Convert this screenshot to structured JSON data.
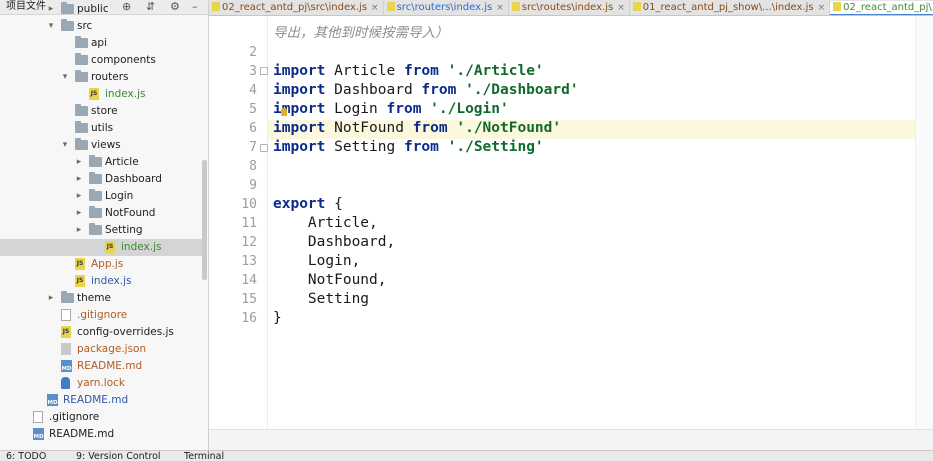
{
  "panel": {
    "title": "项目文件",
    "rows": [
      {
        "label": "public",
        "kind": "folder",
        "color": "c-dark",
        "expanded": false,
        "depth": 1
      },
      {
        "label": "src",
        "kind": "folder",
        "color": "c-dark",
        "expanded": true,
        "depth": 1
      },
      {
        "label": "api",
        "kind": "folder",
        "color": "c-dark",
        "expanded": null,
        "depth": 2
      },
      {
        "label": "components",
        "kind": "folder",
        "color": "c-dark",
        "expanded": null,
        "depth": 2
      },
      {
        "label": "routers",
        "kind": "folder",
        "color": "c-dark",
        "expanded": true,
        "depth": 2
      },
      {
        "label": "index.js",
        "kind": "js",
        "color": "c-green",
        "expanded": null,
        "depth": 3
      },
      {
        "label": "store",
        "kind": "folder",
        "color": "c-dark",
        "expanded": null,
        "depth": 2
      },
      {
        "label": "utils",
        "kind": "folder",
        "color": "c-dark",
        "expanded": null,
        "depth": 2
      },
      {
        "label": "views",
        "kind": "folder",
        "color": "c-dark",
        "expanded": true,
        "depth": 2
      },
      {
        "label": "Article",
        "kind": "folder",
        "color": "c-dark",
        "expanded": false,
        "depth": 3
      },
      {
        "label": "Dashboard",
        "kind": "folder",
        "color": "c-dark",
        "expanded": false,
        "depth": 3
      },
      {
        "label": "Login",
        "kind": "folder",
        "color": "c-dark",
        "expanded": false,
        "depth": 3
      },
      {
        "label": "NotFound",
        "kind": "folder",
        "color": "c-dark",
        "expanded": false,
        "depth": 3
      },
      {
        "label": "Setting",
        "kind": "folder",
        "color": "c-dark",
        "expanded": false,
        "depth": 3
      },
      {
        "label": "index.js",
        "kind": "js",
        "color": "c-green",
        "expanded": null,
        "depth": 4,
        "selected": true
      },
      {
        "label": "App.js",
        "kind": "js",
        "color": "c-orange",
        "expanded": null,
        "depth": 2
      },
      {
        "label": "index.js",
        "kind": "js",
        "color": "c-blue",
        "expanded": null,
        "depth": 2
      },
      {
        "label": "theme",
        "kind": "folder",
        "color": "c-dark",
        "expanded": false,
        "depth": 1
      },
      {
        "label": ".gitignore",
        "kind": "git",
        "color": "c-orange",
        "expanded": null,
        "depth": 1
      },
      {
        "label": "config-overrides.js",
        "kind": "js",
        "color": "c-dark",
        "expanded": null,
        "depth": 1
      },
      {
        "label": "package.json",
        "kind": "json",
        "color": "c-orange",
        "expanded": null,
        "depth": 1
      },
      {
        "label": "README.md",
        "kind": "md",
        "color": "c-orange",
        "expanded": null,
        "depth": 1
      },
      {
        "label": "yarn.lock",
        "kind": "lock",
        "color": "c-orange",
        "expanded": null,
        "depth": 1
      },
      {
        "label": "README.md",
        "kind": "md",
        "color": "c-blue",
        "expanded": null,
        "depth": 0
      },
      {
        "label": ".gitignore",
        "kind": "git",
        "color": "c-dark",
        "expanded": null,
        "depth": -1
      },
      {
        "label": "README.md",
        "kind": "md",
        "color": "c-dark",
        "expanded": null,
        "depth": -1
      }
    ]
  },
  "tabs": [
    {
      "label": "02_react_antd_pj\\src\\index.js",
      "color": "tab-orange",
      "active": false
    },
    {
      "label": "src\\routers\\index.js",
      "color": "tab-blue",
      "active": false
    },
    {
      "label": "src\\routes\\index.js",
      "color": "tab-orange",
      "active": false
    },
    {
      "label": "01_react_antd_pj_show\\...\\index.js",
      "color": "tab-orange",
      "active": false
    },
    {
      "label": "02_react_antd_pj\\...\\index.js",
      "color": "tab-green",
      "active": true
    }
  ],
  "editor": {
    "comment_line": "导出，其他到时候按需导入）",
    "line_numbers": [
      "2",
      "3",
      "4",
      "5",
      "6",
      "7",
      "8",
      "9",
      "10",
      "11",
      "12",
      "13",
      "14",
      "15",
      "16"
    ],
    "imports": [
      {
        "kw": "import",
        "name": " Article ",
        "from": "from",
        "path": "'./Article'"
      },
      {
        "kw": "import",
        "name": " Dashboard ",
        "from": "from",
        "path": "'./Dashboard'"
      },
      {
        "kw": "import",
        "name": " Login ",
        "from": "from",
        "path": "'./Login'"
      },
      {
        "kw": "import",
        "name": " NotFound ",
        "from": "from",
        "path": "'./NotFound'"
      },
      {
        "kw": "import",
        "name": " Setting ",
        "from": "from",
        "path": "'./Setting'"
      }
    ],
    "export_kw": "export",
    "export_open": " {",
    "export_items": [
      "    Article,",
      "    Dashboard,",
      "    Login,",
      "    NotFound,",
      "    Setting"
    ],
    "export_close": "}"
  },
  "bottom_bar": {
    "todo": "6: TODO",
    "vcs": "9: Version Control",
    "terminal": "Terminal"
  },
  "icons": {
    "target": "locate-icon",
    "settings": "gear-icon",
    "hide": "minimize-icon",
    "collapse": "collapse-all-icon"
  }
}
